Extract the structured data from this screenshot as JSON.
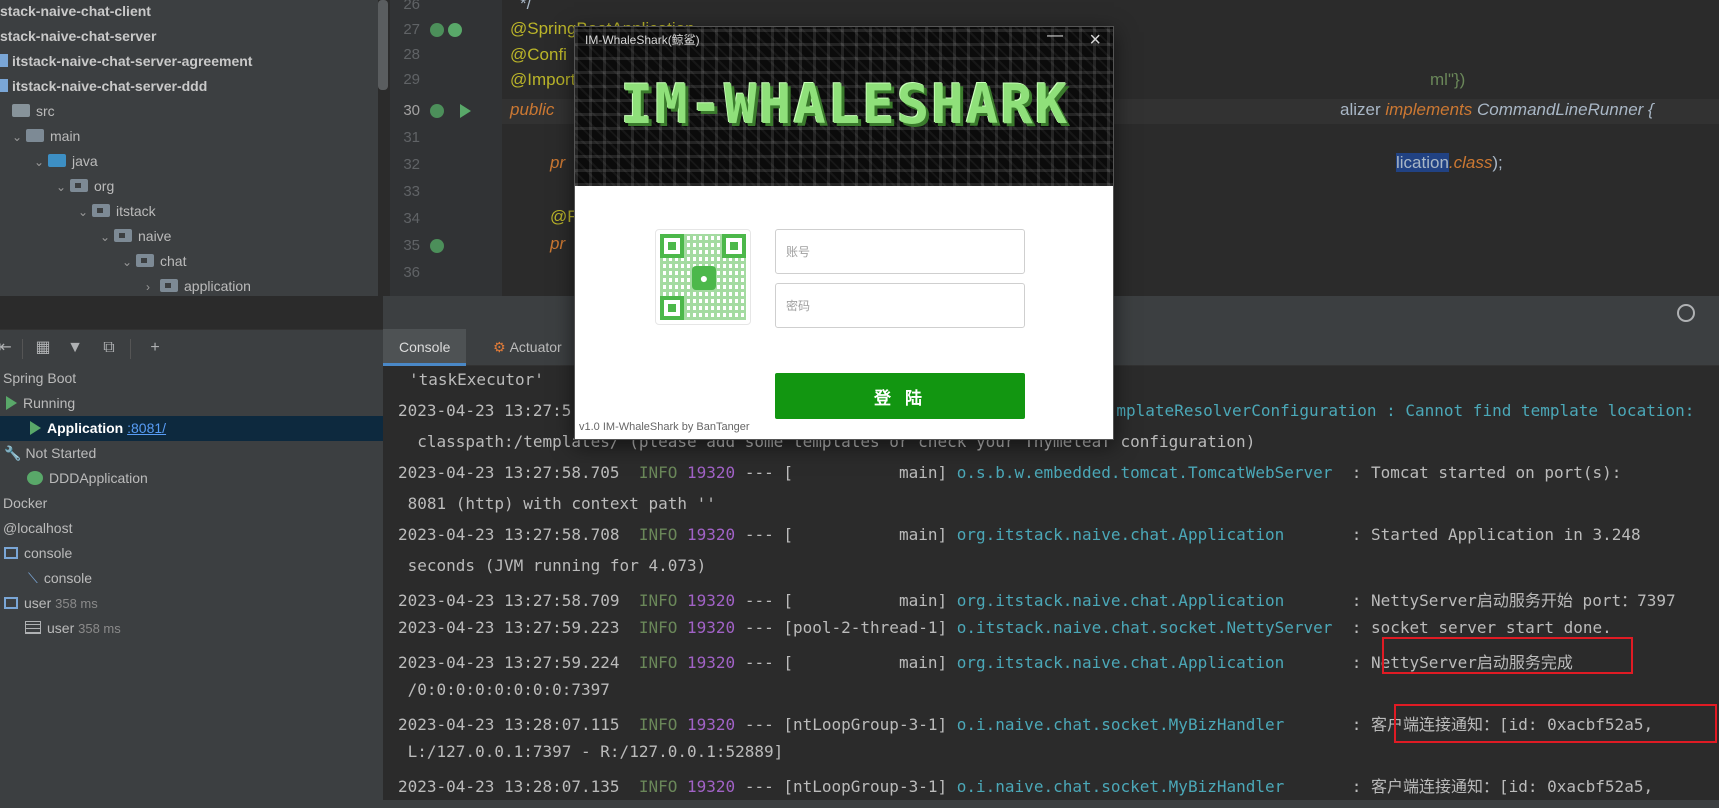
{
  "project_tree": {
    "items": [
      {
        "label": "stack-naive-chat-client",
        "bold": true
      },
      {
        "label": "stack-naive-chat-server",
        "bold": true
      },
      {
        "label": "itstack-naive-chat-server-agreement",
        "bold": true
      },
      {
        "label": "itstack-naive-chat-server-ddd",
        "bold": true
      },
      {
        "label": "src"
      },
      {
        "label": "main"
      },
      {
        "label": "java"
      },
      {
        "label": "org"
      },
      {
        "label": "itstack"
      },
      {
        "label": "naive"
      },
      {
        "label": "chat"
      },
      {
        "label": "application"
      }
    ]
  },
  "editor": {
    "line_numbers": [
      "26",
      "27",
      "28",
      "29",
      "30",
      "31",
      "32",
      "33",
      "34",
      "35",
      "36"
    ],
    "current_line": "30",
    "lines": {
      "l26": "*/",
      "l27": "@SpringBootApplication",
      "l28": "@Confi",
      "l29_a": "@Import",
      "l29_b": "ml\"})",
      "l30_a": "public",
      "l30_b": "alizer",
      "l30_c": "implements",
      "l30_d": "CommandLineRunner {",
      "l32_a": "pr",
      "l32_b": "lication",
      "l32_c": ".class",
      "l32_d": ");",
      "l34": "@R",
      "l35": "pr"
    }
  },
  "services": {
    "toolbar_icons": [
      "collapse-icon",
      "group-icon",
      "filter-icon",
      "new-tab-icon",
      "add-icon"
    ],
    "items": [
      {
        "label": "Spring Boot"
      },
      {
        "label": "Running"
      },
      {
        "label": "Application",
        "port": ":8081/"
      },
      {
        "label": "Not Started"
      },
      {
        "label": "DDDApplication"
      },
      {
        "label": "Docker"
      },
      {
        "label": "@localhost"
      },
      {
        "label": "console"
      },
      {
        "label": "console"
      },
      {
        "label": "user",
        "time": "358 ms"
      },
      {
        "label": "user",
        "time": "358 ms"
      }
    ]
  },
  "console_tabs": [
    {
      "label": "Console",
      "active": true
    },
    {
      "label": "Actuator",
      "active": false
    }
  ],
  "console": {
    "lines": [
      {
        "text": "'taskExecutor'"
      },
      {
        "date": "2023-04-23 13:27:5",
        "rest": "mplateResolverConfiguration : Cannot find template location:"
      },
      {
        "text": "  classpath:/templates/ (please add some templates or check your Thymeleaf configuration)"
      },
      {
        "date": "2023-04-23 13:27:58.705",
        "level": "INFO",
        "pid": "19320",
        "thread": "--- [           main]",
        "logger": "o.s.b.w.embedded.tomcat.TomcatWebServer ",
        "msg": " : Tomcat started on port(s):"
      },
      {
        "text": " 8081 (http) with context path ''"
      },
      {
        "date": "2023-04-23 13:27:58.708",
        "level": "INFO",
        "pid": "19320",
        "thread": "--- [           main]",
        "logger": "org.itstack.naive.chat.Application      ",
        "msg": " : Started Application in 3.248"
      },
      {
        "text": " seconds (JVM running for 4.073)"
      },
      {
        "date": "2023-04-23 13:27:58.709",
        "level": "INFO",
        "pid": "19320",
        "thread": "--- [           main]",
        "logger": "org.itstack.naive.chat.Application      ",
        "msg": " : NettyServer启动服务开始 port：7397"
      },
      {
        "date": "2023-04-23 13:27:59.223",
        "level": "INFO",
        "pid": "19320",
        "thread": "--- [pool-2-thread-1]",
        "logger": "o.itstack.naive.chat.socket.NettyServer ",
        "msg": " : socket server start done."
      },
      {
        "date": "2023-04-23 13:27:59.224",
        "level": "INFO",
        "pid": "19320",
        "thread": "--- [           main]",
        "logger": "org.itstack.naive.chat.Application      ",
        "msg": " : NettyServer启动服务完成"
      },
      {
        "text": " /0:0:0:0:0:0:0:0:7397"
      },
      {
        "date": "2023-04-23 13:28:07.115",
        "level": "INFO",
        "pid": "19320",
        "thread": "--- [ntLoopGroup-3-1]",
        "logger": "o.i.naive.chat.socket.MyBizHandler      ",
        "msg": " : 客户端连接通知：[id: 0xacbf52a5,"
      },
      {
        "text": " L:/127.0.0.1:7397 - R:/127.0.0.1:52889]"
      },
      {
        "date": "2023-04-23 13:28:07.135",
        "level": "INFO",
        "pid": "19320",
        "thread": "--- [ntLoopGroup-3-1]",
        "logger": "o.i.naive.chat.socket.MyBizHandler      ",
        "msg": " : 客户端连接通知：[id: 0xacbf52a5,"
      }
    ]
  },
  "login_dialog": {
    "window_title": "IM-WhaleShark(鲸鲨)",
    "banner_title": "IM-WHALESHARK",
    "account_placeholder": "账号",
    "password_placeholder": "密码",
    "login_label": "登 陆",
    "footer": "v1.0 IM-WhaleShark by BanTanger",
    "min_label": "—",
    "close_label": "×"
  },
  "colors": {
    "login_green": "#129611",
    "highlight_red": "#e01b24",
    "banner_green": "#8fe07a",
    "log_info": "#6a8759",
    "log_pid": "#a162c6",
    "log_logger": "#4ba8b8"
  }
}
